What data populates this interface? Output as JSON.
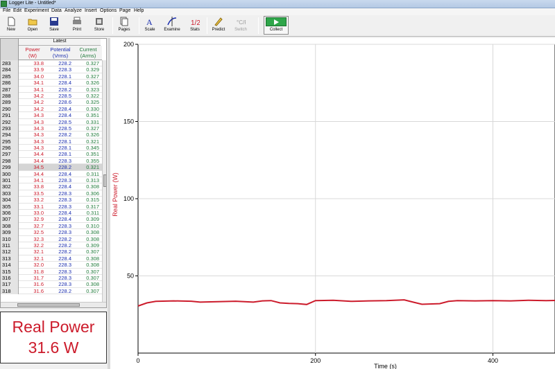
{
  "window": {
    "title": "Logger Lite - Untitled*"
  },
  "menu": [
    "File",
    "Edit",
    "Experiment",
    "Data",
    "Analyze",
    "Insert",
    "Options",
    "Page",
    "Help"
  ],
  "toolbar": {
    "new": "New",
    "open": "Open",
    "save": "Save",
    "print": "Print",
    "store": "Store",
    "pages": "Pages",
    "scale": "Scale",
    "examine": "Examine",
    "stats": "Stats",
    "predict": "Predict",
    "switch": "Switch",
    "collect": "Collect"
  },
  "table": {
    "group": "Latest",
    "columns": [
      {
        "name": "Power",
        "unit": "(W)"
      },
      {
        "name": "Potential",
        "unit": "(Vrms)"
      },
      {
        "name": "Current",
        "unit": "(Arms)"
      }
    ],
    "selected_row": 299,
    "rows": [
      [
        283,
        "33.8",
        "228.2",
        "0.327"
      ],
      [
        284,
        "33.9",
        "228.3",
        "0.329"
      ],
      [
        285,
        "34.0",
        "228.1",
        "0.327"
      ],
      [
        286,
        "34.1",
        "228.4",
        "0.326"
      ],
      [
        287,
        "34.1",
        "228.2",
        "0.323"
      ],
      [
        288,
        "34.2",
        "228.5",
        "0.322"
      ],
      [
        289,
        "34.2",
        "228.6",
        "0.325"
      ],
      [
        290,
        "34.2",
        "228.4",
        "0.330"
      ],
      [
        291,
        "34.3",
        "228.4",
        "0.351"
      ],
      [
        292,
        "34.3",
        "228.5",
        "0.331"
      ],
      [
        293,
        "34.3",
        "228.5",
        "0.327"
      ],
      [
        294,
        "34.3",
        "228.2",
        "0.326"
      ],
      [
        295,
        "34.3",
        "228.1",
        "0.321"
      ],
      [
        296,
        "34.3",
        "228.1",
        "0.345"
      ],
      [
        297,
        "34.4",
        "228.1",
        "0.351"
      ],
      [
        298,
        "34.4",
        "228.3",
        "0.355"
      ],
      [
        299,
        "34.5",
        "228.2",
        "0.321"
      ],
      [
        300,
        "34.4",
        "228.4",
        "0.311"
      ],
      [
        301,
        "34.1",
        "228.3",
        "0.313"
      ],
      [
        302,
        "33.8",
        "228.4",
        "0.308"
      ],
      [
        303,
        "33.5",
        "228.3",
        "0.306"
      ],
      [
        304,
        "33.2",
        "228.3",
        "0.315"
      ],
      [
        305,
        "33.1",
        "228.3",
        "0.317"
      ],
      [
        306,
        "33.0",
        "228.4",
        "0.311"
      ],
      [
        307,
        "32.9",
        "228.4",
        "0.309"
      ],
      [
        308,
        "32.7",
        "228.3",
        "0.310"
      ],
      [
        309,
        "32.5",
        "228.3",
        "0.308"
      ],
      [
        310,
        "32.3",
        "228.2",
        "0.308"
      ],
      [
        311,
        "32.2",
        "228.2",
        "0.309"
      ],
      [
        312,
        "32.1",
        "228.2",
        "0.307"
      ],
      [
        313,
        "32.1",
        "228.4",
        "0.308"
      ],
      [
        314,
        "32.0",
        "228.3",
        "0.308"
      ],
      [
        315,
        "31.8",
        "228.3",
        "0.307"
      ],
      [
        316,
        "31.7",
        "228.3",
        "0.307"
      ],
      [
        317,
        "31.6",
        "228.3",
        "0.308"
      ],
      [
        318,
        "31.6",
        "228.2",
        "0.307"
      ]
    ]
  },
  "meter": {
    "label": "Real Power",
    "value": "31.6 W"
  },
  "colors": {
    "power": "#cc1b2b",
    "potential": "#1a2dae",
    "current": "#1f7a3a",
    "collect": "#2fa64a"
  },
  "chart_data": {
    "type": "line",
    "xlabel": "Time (s)",
    "ylabel": "Real Power (W)",
    "xlim": [
      0,
      470
    ],
    "ylim": [
      0,
      200
    ],
    "xticks": [
      0,
      200,
      400
    ],
    "yticks": [
      50,
      100,
      150,
      200
    ],
    "grid": true,
    "series": [
      {
        "name": "Real Power",
        "color": "#cc1b2b",
        "x": [
          0,
          10,
          20,
          40,
          60,
          70,
          90,
          110,
          130,
          140,
          150,
          160,
          170,
          180,
          190,
          200,
          220,
          240,
          260,
          280,
          300,
          310,
          320,
          340,
          350,
          360,
          380,
          400,
          420,
          440,
          460,
          470
        ],
        "y": [
          30.5,
          32.5,
          33.5,
          33.8,
          33.6,
          33.0,
          33.3,
          33.6,
          33.0,
          33.8,
          34.0,
          32.5,
          32.2,
          32.0,
          31.5,
          34.0,
          34.2,
          33.5,
          33.8,
          34.0,
          34.5,
          33.0,
          31.6,
          32.0,
          33.5,
          34.0,
          33.8,
          34.0,
          33.8,
          34.2,
          34.0,
          34.1
        ]
      }
    ]
  }
}
